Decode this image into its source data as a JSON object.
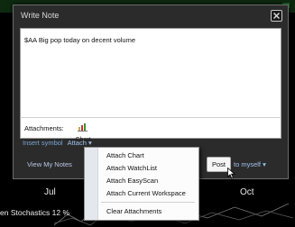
{
  "window": {
    "title": "Write Note",
    "note_text": "$AA Big pop today on decent volume",
    "attachments_label": "Attachments:",
    "attachment_name": "Chart",
    "insert_symbol": "Insert symbol",
    "attach": "Attach ▾",
    "view_my_notes": "View My Notes",
    "post": "Post",
    "to_myself": "to myself ▾"
  },
  "menu": {
    "items": [
      {
        "label": "Attach Chart"
      },
      {
        "label": "Attach WatchList"
      },
      {
        "label": "Attach EasyScan"
      },
      {
        "label": "Attach Current Workspace"
      },
      {
        "label": "Clear Attachments"
      }
    ]
  },
  "background": {
    "months": [
      "Jul",
      "Oct"
    ],
    "indicator_label": "en Stochastics 12 %"
  },
  "colors": {
    "window_bg": "#2b2b2b",
    "link": "#9fc2ea",
    "menu_bg": "#fcfcfc"
  },
  "icons": [
    "close-icon",
    "chart-attachment-icon",
    "mouse-cursor-icon"
  ]
}
